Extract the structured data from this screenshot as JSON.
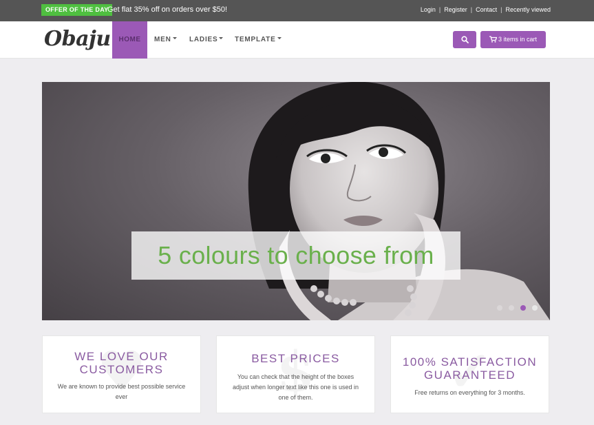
{
  "topbar": {
    "offer_badge": "OFFER OF THE DAY",
    "offer_text": "Get flat 35% off on orders over $50!",
    "links": [
      "Login",
      "Register",
      "Contact",
      "Recently viewed"
    ]
  },
  "navbar": {
    "logo": "Obaju",
    "home": "HOME",
    "men": "MEN",
    "ladies": "LADIES",
    "template": "TEMPLATE",
    "cart_label": "3 items in cart"
  },
  "hero": {
    "caption": "5 colours to choose from",
    "slides": 4,
    "active_slide": 3
  },
  "features": [
    {
      "title_line1": "WE LOVE OUR",
      "title_line2": "CUSTOMERS",
      "text": "We are known to provide best possible service ever"
    },
    {
      "title_line1": "BEST PRICES",
      "title_line2": "",
      "text": "You can check that the height of the boxes adjust when longer text like this one is used in one of them."
    },
    {
      "title_line1": "100% SATISFACTION",
      "title_line2": "GUARANTEED",
      "text": "Free returns on everything for 3 months."
    }
  ],
  "colors": {
    "accent": "#9b59b6",
    "offer_green": "#4fbf40",
    "caption_green": "#6ab04c",
    "topbar": "#555555"
  }
}
